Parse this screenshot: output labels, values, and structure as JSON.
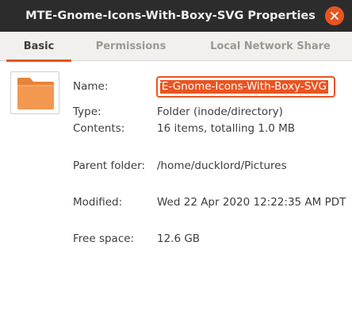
{
  "window": {
    "title": "MTE-Gnome-Icons-With-Boxy-SVG Properties"
  },
  "tabs": [
    {
      "label": "Basic",
      "active": true
    },
    {
      "label": "Permissions",
      "active": false
    },
    {
      "label": "Local Network Share",
      "active": false
    }
  ],
  "icons": {
    "close": "close-icon",
    "folder": "folder-icon"
  },
  "colors": {
    "accent": "#e95420",
    "titlebar": "#2c2c2c",
    "folder": "#f29850"
  },
  "basic": {
    "name_label": "Name:",
    "name_value": "MTE-Gnome-Icons-With-Boxy-SVG",
    "type_label": "Type:",
    "type_value": "Folder (inode/directory)",
    "contents_label": "Contents:",
    "contents_value": "16 items, totalling 1.0 MB",
    "parent_label": "Parent folder:",
    "parent_value": "/home/ducklord/Pictures",
    "modified_label": "Modified:",
    "modified_value": "Wed 22 Apr 2020 12:22:35 AM PDT",
    "free_label": "Free space:",
    "free_value": "12.6 GB"
  }
}
